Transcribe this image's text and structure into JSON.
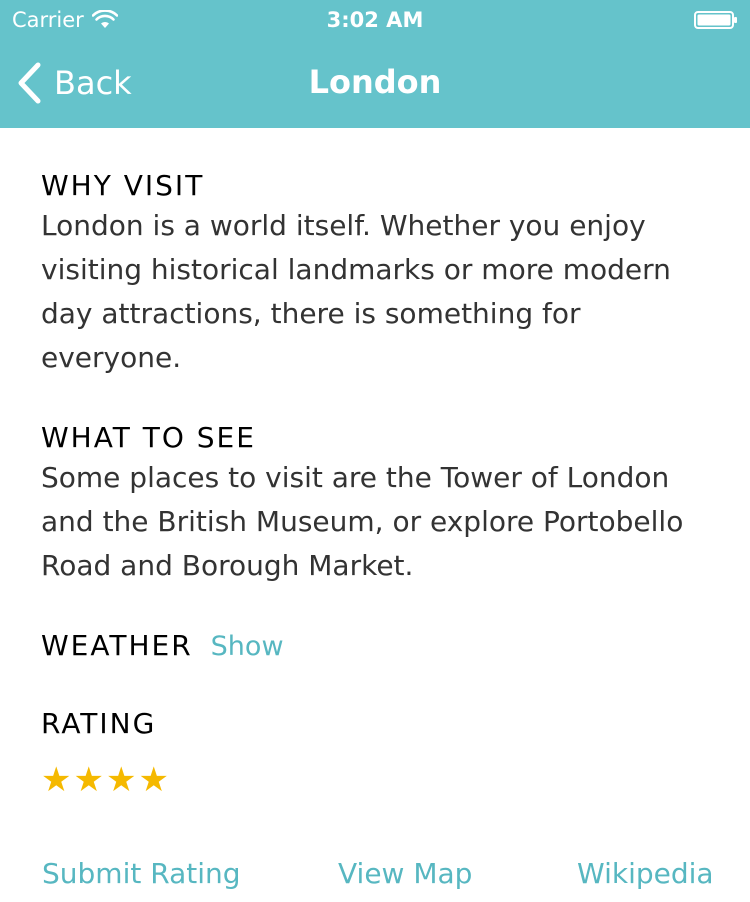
{
  "status_bar": {
    "carrier": "Carrier",
    "time": "3:02 AM",
    "wifi_icon": "wifi-icon",
    "battery_icon": "battery-icon"
  },
  "nav_bar": {
    "back_label": "Back",
    "title": "London",
    "back_icon": "chevron-left-icon",
    "background_color": "#65c3cb"
  },
  "sections": {
    "why_visit": {
      "heading": "WHY VISIT",
      "body": "London is a world itself. Whether you enjoy visiting historical landmarks or more modern day attractions, there is something for everyone."
    },
    "what_to_see": {
      "heading": "WHAT TO SEE",
      "body": "Some places to visit are the Tower of London and the British Museum, or explore Portobello Road and Borough Market."
    },
    "weather": {
      "heading": "WEATHER",
      "link": "Show"
    },
    "rating": {
      "heading": "RATING",
      "stars": 4,
      "star_glyph": "★",
      "star_color": "#f5b900"
    }
  },
  "actions": {
    "submit_rating": "Submit Rating",
    "view_map": "View Map",
    "wikipedia": "Wikipedia",
    "link_color": "#57b7c1"
  }
}
